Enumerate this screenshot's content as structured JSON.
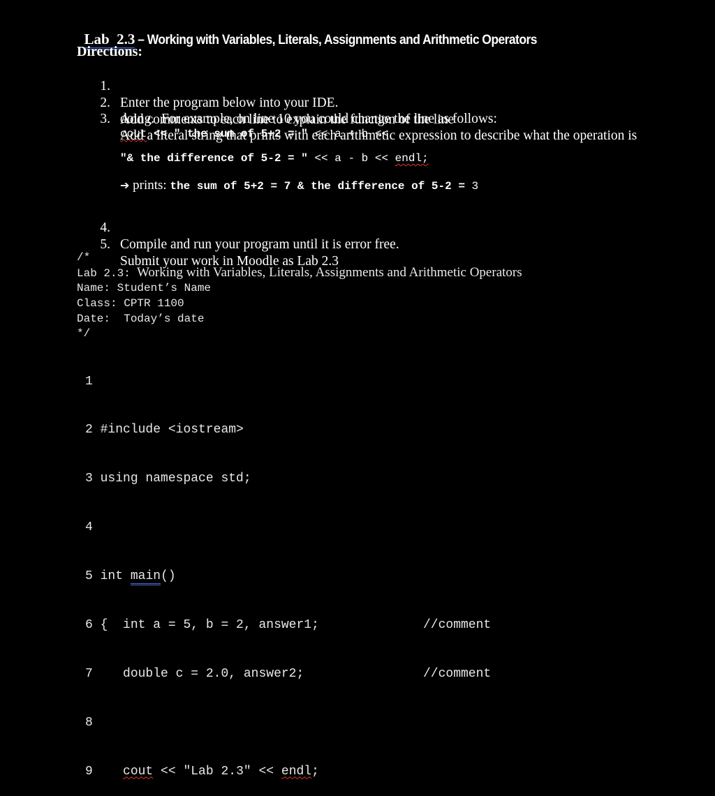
{
  "title": {
    "lab_label": "Lab  2.3",
    "subtitle": " – Working with Variables, Literals, Assignments and Arithmetic Operators"
  },
  "directions": {
    "heading": "Directions:",
    "items": [
      {
        "num": "1.",
        "text": "Enter the program below into your IDE."
      },
      {
        "num": "2.",
        "text": "Add comments to each line to explain the function of the line"
      },
      {
        "num": "3.",
        "text": "Add a literal string that prints with each arithmetic expression to describe what the operation is",
        "text2": "doing.  For example, on line 10 you could change the line as follows:"
      },
      {
        "num": "4.",
        "text": "Compile and run your program until it is error free."
      },
      {
        "num": "5.",
        "text": "Submit your work in Moodle as Lab 2.3"
      }
    ],
    "example": {
      "line1_cout": "cout",
      "line1_bold": " << \" the sum of 5+2 = \"",
      "line1_rest": " << a + b <<",
      "line2_bold": "\"& the difference of 5-2 = \"",
      "line2_rest": " << a - b << ",
      "line2_endl": "endl;",
      "arrow": "➔",
      "prints_label": " prints: ",
      "prints_bold": "the sum of 5+2 = 7 & the difference of 5-2 =",
      "prints_value": " 3"
    }
  },
  "header_comment": {
    "open": "/*",
    "lab_prefix": "Lab 2.3:",
    "lab_title": "  Working with Variables, Literals, Assignments and Arithmetic Operators",
    "name": "Name: Student’s Name",
    "class": "Class: CPTR 1100",
    "date": "Date:  Today’s date",
    "close": "*/"
  },
  "code_lines": [
    {
      "n": "1",
      "code": ""
    },
    {
      "n": "2",
      "code": "#include <iostream>"
    },
    {
      "n": "3",
      "code": "using namespace std;"
    },
    {
      "n": "4",
      "code": ""
    },
    {
      "n": "5",
      "code_pre": "int ",
      "code_main": "main",
      "code_post": "()"
    },
    {
      "n": "6",
      "code": "{  int a = 5, b = 2, answer1;",
      "comment": "//comment"
    },
    {
      "n": "7",
      "code": "   double c = 2.0, answer2;",
      "comment": "//comment"
    },
    {
      "n": "8",
      "code": ""
    },
    {
      "n": "9",
      "code_cout": "cout",
      "code_mid": " << \"Lab 2.3\" << ",
      "code_endl": "endl",
      "code_end": ";"
    }
  ]
}
